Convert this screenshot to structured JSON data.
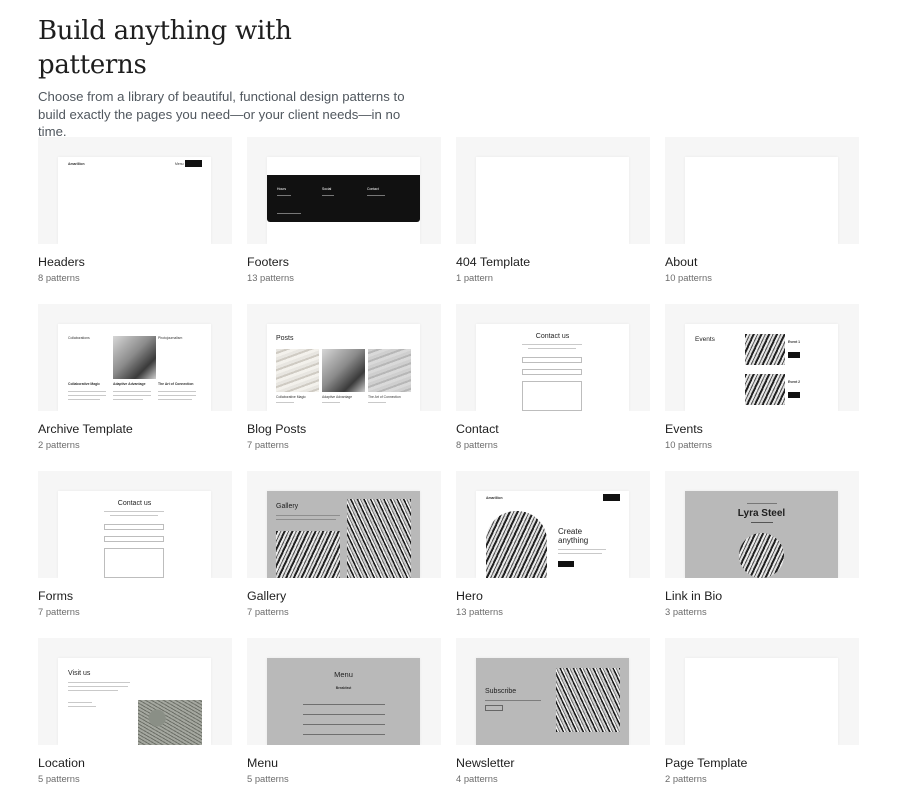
{
  "hero": {
    "title": "Build anything with patterns",
    "description": "Choose from a library of beautiful, functional design patterns to build exactly the pages you need—or your client needs—in no time."
  },
  "categories": [
    {
      "title": "Headers",
      "count": "8 patterns",
      "preview": "headers-preview"
    },
    {
      "title": "Footers",
      "count": "13 patterns",
      "preview": "footers-preview"
    },
    {
      "title": "404 Template",
      "count": "1 pattern",
      "preview": "blank-preview"
    },
    {
      "title": "About",
      "count": "10 patterns",
      "preview": "blank-preview"
    },
    {
      "title": "Archive Template",
      "count": "2 patterns",
      "preview": "archive-preview"
    },
    {
      "title": "Blog Posts",
      "count": "7 patterns",
      "preview": "blog-preview"
    },
    {
      "title": "Contact",
      "count": "8 patterns",
      "preview": "contact-preview"
    },
    {
      "title": "Events",
      "count": "10 patterns",
      "preview": "events-preview"
    },
    {
      "title": "Forms",
      "count": "7 patterns",
      "preview": "forms-preview"
    },
    {
      "title": "Gallery",
      "count": "7 patterns",
      "preview": "gallery-preview"
    },
    {
      "title": "Hero",
      "count": "13 patterns",
      "preview": "hero-preview"
    },
    {
      "title": "Link in Bio",
      "count": "3 patterns",
      "preview": "link-in-bio-preview"
    },
    {
      "title": "Location",
      "count": "5 patterns",
      "preview": "location-preview"
    },
    {
      "title": "Menu",
      "count": "5 patterns",
      "preview": "menu-preview"
    },
    {
      "title": "Newsletter",
      "count": "4 patterns",
      "preview": "newsletter-preview"
    },
    {
      "title": "Page Template",
      "count": "2 patterns",
      "preview": "blank-preview"
    }
  ],
  "previews": {
    "headers": {
      "site": "Amarillion",
      "nav": "Menu",
      "button": "Get in touch"
    },
    "footers": {
      "col1": "Hours",
      "col2": "Social",
      "col3": "Contact"
    },
    "archive": {
      "left": "Collaborations",
      "right": "Photojournalism",
      "posts": [
        "Collaborative Magic",
        "Adaptive Advantage",
        "The Art of Connection"
      ]
    },
    "blog": {
      "heading": "Posts",
      "posts": [
        "Collaborative Magic",
        "Adaptive Advantage",
        "The Art of Connection"
      ]
    },
    "contact": {
      "heading": "Contact us"
    },
    "events": {
      "heading": "Events",
      "event1": "Event 1",
      "event2": "Event 2"
    },
    "forms": {
      "heading": "Contact us"
    },
    "gallery": {
      "heading": "Gallery"
    },
    "hero": {
      "site": "Amarillion",
      "heading": "Create anything"
    },
    "link_in_bio": {
      "name": "Lyra Steel"
    },
    "location": {
      "heading": "Visit us"
    },
    "menu": {
      "heading": "Menu",
      "subheading": "Breakfast"
    },
    "newsletter": {
      "heading": "Subscribe"
    }
  },
  "colors": {
    "thumb_bg": "#f6f6f6",
    "title": "#1e1e1e",
    "muted": "#6c6c6c",
    "dark": "#111111",
    "gray_panel": "#b9b9b9"
  }
}
